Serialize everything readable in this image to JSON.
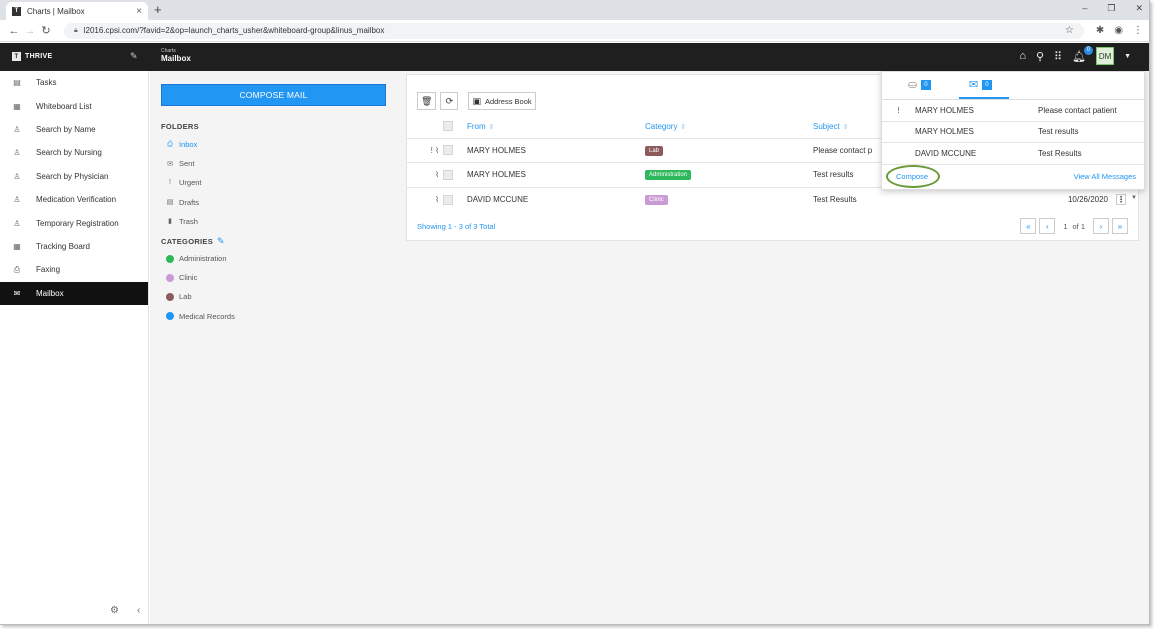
{
  "browser": {
    "tab_title": "Charts | Mailbox",
    "tab_favicon": "T",
    "url": "l2016.cpsi.com/?favid=2&op=launch_charts_usher&whiteboard-group&linus_mailbox"
  },
  "header": {
    "brand": "THRIVE",
    "brand_logo": "T",
    "app_name": "Charts",
    "page_title": "Mailbox",
    "bell_count": "0",
    "avatar_initials": "DM"
  },
  "sidebar": {
    "items": [
      {
        "label": "Tasks",
        "icon": "clipboard-icon",
        "glyph": "▤"
      },
      {
        "label": "Whiteboard List",
        "icon": "whiteboard-icon",
        "glyph": "▦"
      },
      {
        "label": "Search by Name",
        "icon": "user-search-icon",
        "glyph": "♙"
      },
      {
        "label": "Search by Nursing",
        "icon": "nurse-search-icon",
        "glyph": "♙"
      },
      {
        "label": "Search by Physician",
        "icon": "physician-search-icon",
        "glyph": "♙"
      },
      {
        "label": "Medication Verification",
        "icon": "medication-icon",
        "glyph": "♙"
      },
      {
        "label": "Temporary Registration",
        "icon": "registration-icon",
        "glyph": "♙"
      },
      {
        "label": "Tracking Board",
        "icon": "tracking-board-icon",
        "glyph": "▦"
      },
      {
        "label": "Faxing",
        "icon": "fax-icon",
        "glyph": "⎙"
      },
      {
        "label": "Mailbox",
        "icon": "mailbox-icon",
        "glyph": "✉"
      }
    ]
  },
  "folders_panel": {
    "compose_label": "COMPOSE MAIL",
    "folders_heading": "FOLDERS",
    "folders": [
      {
        "label": "Inbox",
        "glyph": "⎙"
      },
      {
        "label": "Sent",
        "glyph": "✉"
      },
      {
        "label": "Urgent",
        "glyph": "!"
      },
      {
        "label": "Drafts",
        "glyph": "▤"
      },
      {
        "label": "Trash",
        "glyph": "▮"
      }
    ],
    "categories_heading": "CATEGORIES",
    "categories": [
      {
        "label": "Administration",
        "color": "#2eb85c"
      },
      {
        "label": "Clinic",
        "color": "#c99ad6"
      },
      {
        "label": "Lab",
        "color": "#8d5b5b"
      },
      {
        "label": "Medical Records",
        "color": "#2196f3"
      }
    ]
  },
  "mail_list": {
    "address_book_label": "Address Book",
    "columns": {
      "from": "From",
      "category": "Category",
      "subject": "Subject"
    },
    "rows": [
      {
        "flags": "! ⌇",
        "from": "MARY HOLMES",
        "category": "Lab",
        "category_color": "#8d5b5b",
        "subject": "Please contact p",
        "date": ""
      },
      {
        "flags": "⌇",
        "from": "MARY HOLMES",
        "category": "Administration",
        "category_color": "#2eb85c",
        "subject": "Test results",
        "date": ""
      },
      {
        "flags": "⌇",
        "from": "DAVID MCCUNE",
        "category": "Clinic",
        "category_color": "#c99ad6",
        "subject": "Test Results",
        "date": "10/26/2020"
      }
    ],
    "showing_text": "Showing 1 - 3 of 3 Total",
    "page_current": "1",
    "page_of": "of 1"
  },
  "notifications": {
    "inbox_count": "0",
    "mail_count": "0",
    "rows": [
      {
        "flag": "!",
        "from": "MARY HOLMES",
        "subject": "Please contact patient"
      },
      {
        "flag": "",
        "from": "MARY HOLMES",
        "subject": "Test results"
      },
      {
        "flag": "",
        "from": "DAVID MCCUNE",
        "subject": "Test Results"
      }
    ],
    "compose_label": "Compose",
    "view_all_label": "View All Messages"
  }
}
